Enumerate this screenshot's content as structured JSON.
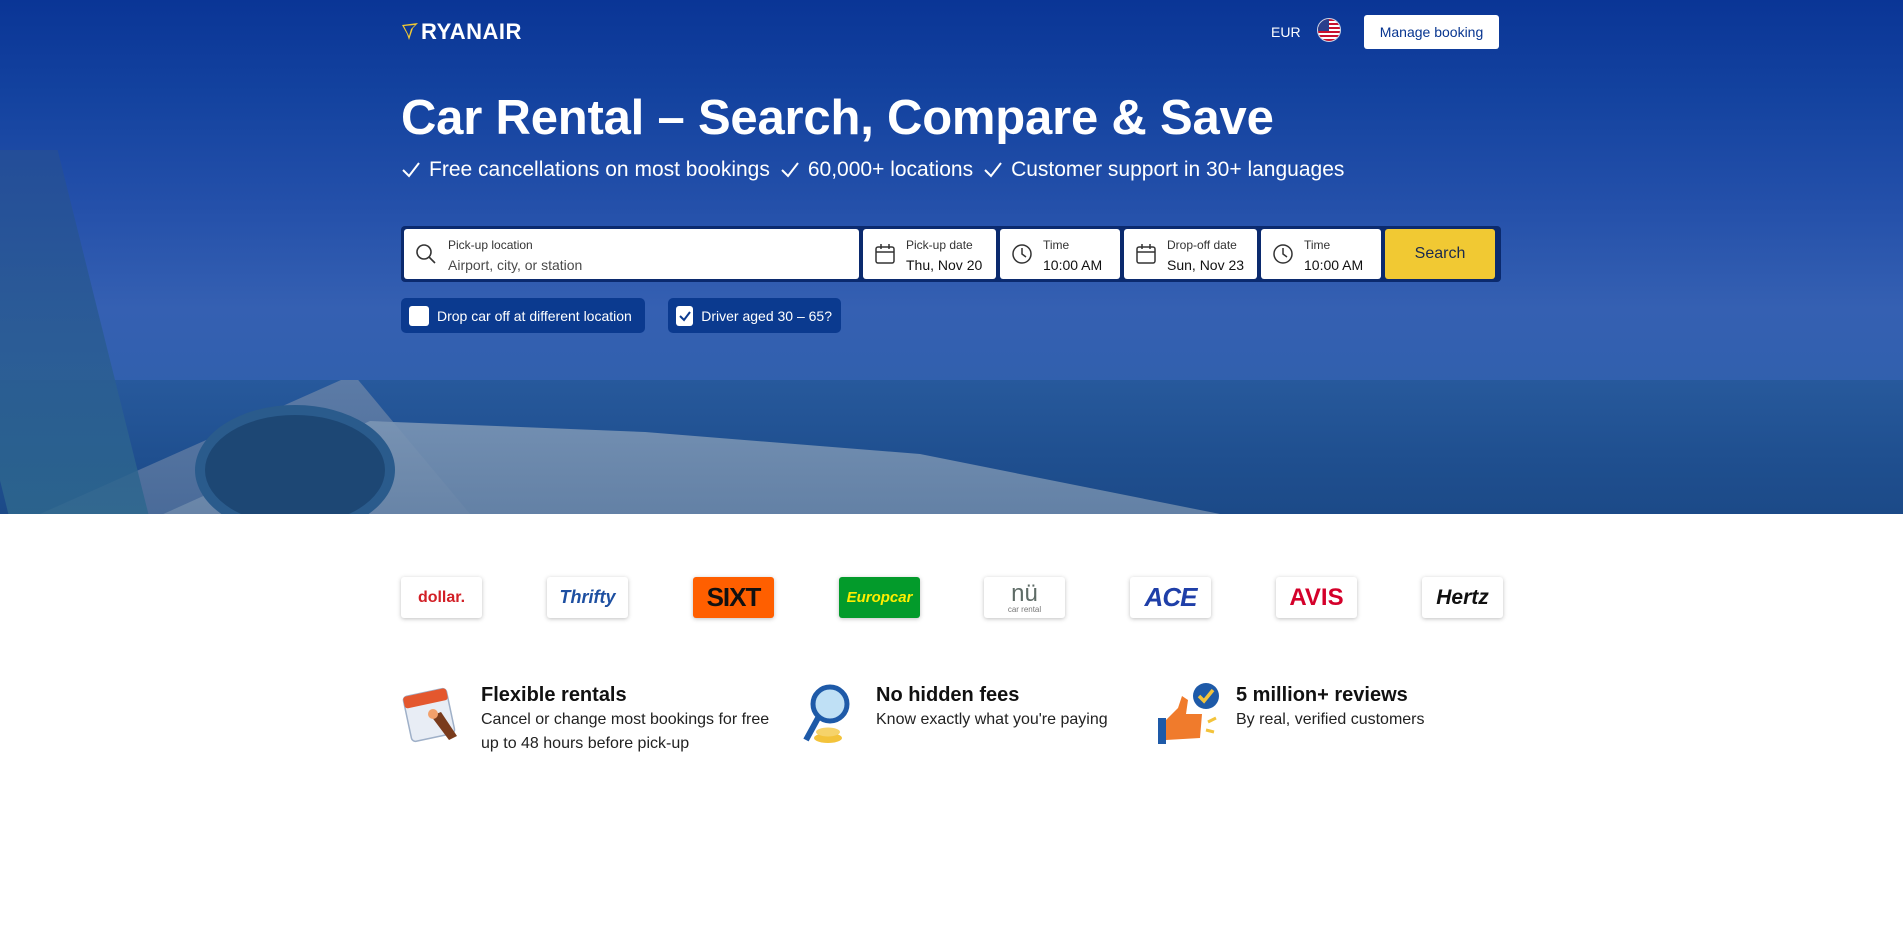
{
  "header": {
    "logo_text": "RYANAIR",
    "currency": "EUR",
    "flag_icon": "us-flag-icon",
    "manage_booking_label": "Manage booking"
  },
  "hero": {
    "title": "Car Rental – Search, Compare & Save",
    "perks": [
      "Free cancellations on most bookings",
      "60,000+ locations",
      "Customer support in 30+ languages"
    ]
  },
  "search": {
    "pickup_location": {
      "label": "Pick-up location",
      "placeholder": "Airport, city, or station",
      "value": ""
    },
    "pickup_date": {
      "label": "Pick-up date",
      "value": "Thu, Nov 20"
    },
    "pickup_time": {
      "label": "Time",
      "value": "10:00 AM"
    },
    "dropoff_date": {
      "label": "Drop-off date",
      "value": "Sun, Nov 23"
    },
    "dropoff_time": {
      "label": "Time",
      "value": "10:00 AM"
    },
    "search_button": "Search"
  },
  "options": {
    "different_location": {
      "label": "Drop car off at different location",
      "checked": false
    },
    "driver_age": {
      "label": "Driver aged 30 – 65?",
      "checked": true
    }
  },
  "brands": {
    "dollar": "dollar.",
    "thrifty": "Thrifty",
    "sixt": "SIXT",
    "europcar": "Europcar",
    "nu": "nü",
    "nu_sub": "car rental",
    "ace": "ACE",
    "avis": "AVIS",
    "hertz": "Hertz"
  },
  "features": [
    {
      "title": "Flexible rentals",
      "text": "Cancel or change most bookings for free up to 48 hours before pick-up",
      "icon": "calendar-hand-icon"
    },
    {
      "title": "No hidden fees",
      "text": "Know exactly what you're paying",
      "icon": "magnifier-coins-icon"
    },
    {
      "title": "5 million+ reviews",
      "text": "By real, verified customers",
      "icon": "thumbs-up-check-icon"
    }
  ],
  "colors": {
    "brand_blue": "#073590",
    "search_yellow": "#f1c933"
  }
}
